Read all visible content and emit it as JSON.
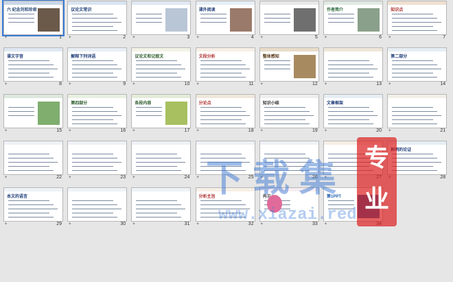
{
  "slides": [
    {
      "n": "1",
      "bar": "#c9d6e8",
      "title": "六 纪念刘和珍君",
      "titleColor": "#2a4a7a",
      "pic": "#6b5a4a"
    },
    {
      "n": "2",
      "bar": "#d8e4f0",
      "title": "议论文常识",
      "titleColor": "#1f3d7a"
    },
    {
      "n": "3",
      "bar": "#e0e8f2",
      "title": "",
      "titleColor": "#1f3d7a",
      "pic": "#b9c6d6"
    },
    {
      "n": "4",
      "bar": "#e6eef6",
      "title": "课外阅读",
      "titleColor": "#1f3d7a",
      "pic": "#9a7a6a"
    },
    {
      "n": "5",
      "bar": "#e8e8e8",
      "title": "",
      "titleColor": "#1f3d7a",
      "pic": "#6f6f6f"
    },
    {
      "n": "6",
      "bar": "#dfeae2",
      "title": "作者简介",
      "titleColor": "#2a6a3a",
      "pic": "#8aa08a"
    },
    {
      "n": "7",
      "bar": "#f0e0d0",
      "title": "知识点",
      "titleColor": "#b03030"
    },
    {
      "n": "8",
      "bar": "#dfe8f2",
      "title": "课文字音",
      "titleColor": "#1f3d7a"
    },
    {
      "n": "9",
      "bar": "#e8eef4",
      "title": "解释下列词语",
      "titleColor": "#1f3d7a"
    },
    {
      "n": "10",
      "bar": "#f2f2e6",
      "title": "议论文和记叙文",
      "titleColor": "#2a5a2a"
    },
    {
      "n": "11",
      "bar": "#f6efe6",
      "title": "文段分析",
      "titleColor": "#b03030"
    },
    {
      "n": "12",
      "bar": "#e8dcc8",
      "title": "整体感知",
      "titleColor": "#5a3a1a",
      "pic": "#a88a60"
    },
    {
      "n": "13",
      "bar": "#efe6d8",
      "title": "",
      "titleColor": "#5a3a1a"
    },
    {
      "n": "14",
      "bar": "#e6eef4",
      "title": "第二部分",
      "titleColor": "#1f3d7a"
    },
    {
      "n": "15",
      "bar": "#dde8dd",
      "title": "",
      "titleColor": "#2a5a2a",
      "pic": "#7fae6f"
    },
    {
      "n": "16",
      "bar": "#e8f0e2",
      "title": "第四部分",
      "titleColor": "#2a5a2a"
    },
    {
      "n": "17",
      "bar": "#e4ecd8",
      "title": "各段内容",
      "titleColor": "#2a5a2a",
      "pic": "#a8c060"
    },
    {
      "n": "18",
      "bar": "#f0e8dc",
      "title": "分论点",
      "titleColor": "#b03030"
    },
    {
      "n": "19",
      "bar": "#eeeeee",
      "title": "知识小结",
      "titleColor": "#333333"
    },
    {
      "n": "20",
      "bar": "#e6eef4",
      "title": "文章框架",
      "titleColor": "#1f3d7a"
    },
    {
      "n": "21",
      "bar": "#f2efe8",
      "title": "",
      "titleColor": "#333333"
    },
    {
      "n": "22",
      "bar": "#eef2f6",
      "title": "",
      "titleColor": "#1f3d7a"
    },
    {
      "n": "23",
      "bar": "#eef2f6",
      "title": "",
      "titleColor": "#1f3d7a"
    },
    {
      "n": "24",
      "bar": "#eef2f6",
      "title": "",
      "titleColor": "#1f3d7a"
    },
    {
      "n": "25",
      "bar": "#eef2f6",
      "title": "",
      "titleColor": "#1f3d7a"
    },
    {
      "n": "26",
      "bar": "#eef2f6",
      "title": "",
      "titleColor": "#1f3d7a"
    },
    {
      "n": "27",
      "bar": "#f6efe6",
      "title": "",
      "titleColor": "#b03030"
    },
    {
      "n": "28",
      "bar": "#e6eef4",
      "title": "鲜明的论证",
      "titleColor": "#1f3d7a"
    },
    {
      "n": "29",
      "bar": "#eef2f6",
      "title": "本文的语言",
      "titleColor": "#1f3d7a"
    },
    {
      "n": "30",
      "bar": "#eef2f6",
      "title": "",
      "titleColor": "#1f3d7a"
    },
    {
      "n": "31",
      "bar": "#eef2f6",
      "title": "",
      "titleColor": "#1f3d7a"
    },
    {
      "n": "32",
      "bar": "#f6efe6",
      "title": "分析主旨",
      "titleColor": "#b03030"
    },
    {
      "n": "33",
      "bar": "#f6eef2",
      "title": "再见！",
      "titleColor": "#555555",
      "pic": "#e06a9a"
    },
    {
      "n": "34",
      "bar": "#ffffff",
      "title": "第1PPT",
      "titleColor": "#1f5fae",
      "pic": "#1f5fae"
    }
  ],
  "watermark": {
    "main": "下载集",
    "url": "www.xiazai.red",
    "seal_top": "专",
    "seal_bottom": "业"
  }
}
